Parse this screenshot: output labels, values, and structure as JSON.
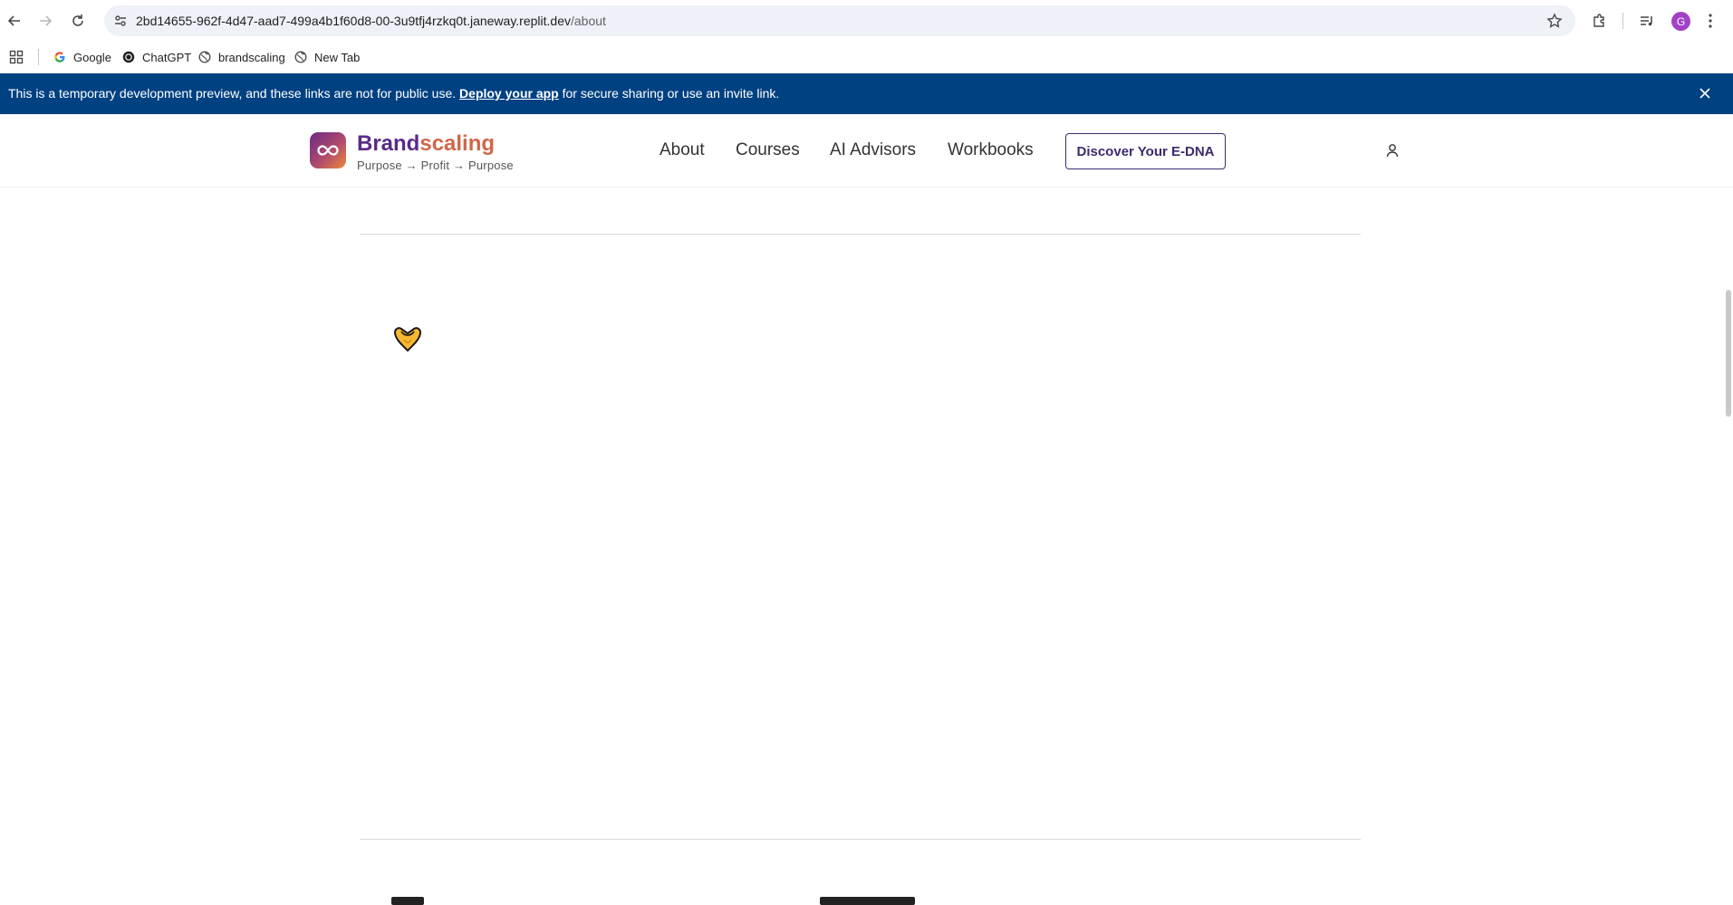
{
  "browser": {
    "url_host": "2bd14655-962f-4d47-aad7-499a4b1f60d8-00-3u9tfj4rzkq0t.janeway.replit.dev",
    "url_path": "/about",
    "profile_initial": "G",
    "bookmarks": [
      {
        "label": "Google",
        "icon": "google-icon"
      },
      {
        "label": "ChatGPT",
        "icon": "chatgpt-icon"
      },
      {
        "label": "brandscaling",
        "icon": "globe-icon"
      },
      {
        "label": "New Tab",
        "icon": "globe-icon"
      }
    ]
  },
  "banner": {
    "text_before": "This is a temporary development preview, and these links are not for public use.",
    "link": "Deploy your app",
    "text_after": "for secure sharing or use an invite link."
  },
  "site": {
    "brand_part1": "Brand",
    "brand_part2": "scaling",
    "tagline": "Purpose → Profit → Purpose",
    "nav": [
      "About",
      "Courses",
      "AI Advisors",
      "Workbooks"
    ],
    "cta": "Discover Your E-DNA"
  },
  "colors": {
    "banner_bg": "#004182",
    "brand_purple": "#5a2a87",
    "brand_orange": "#d0674a"
  }
}
